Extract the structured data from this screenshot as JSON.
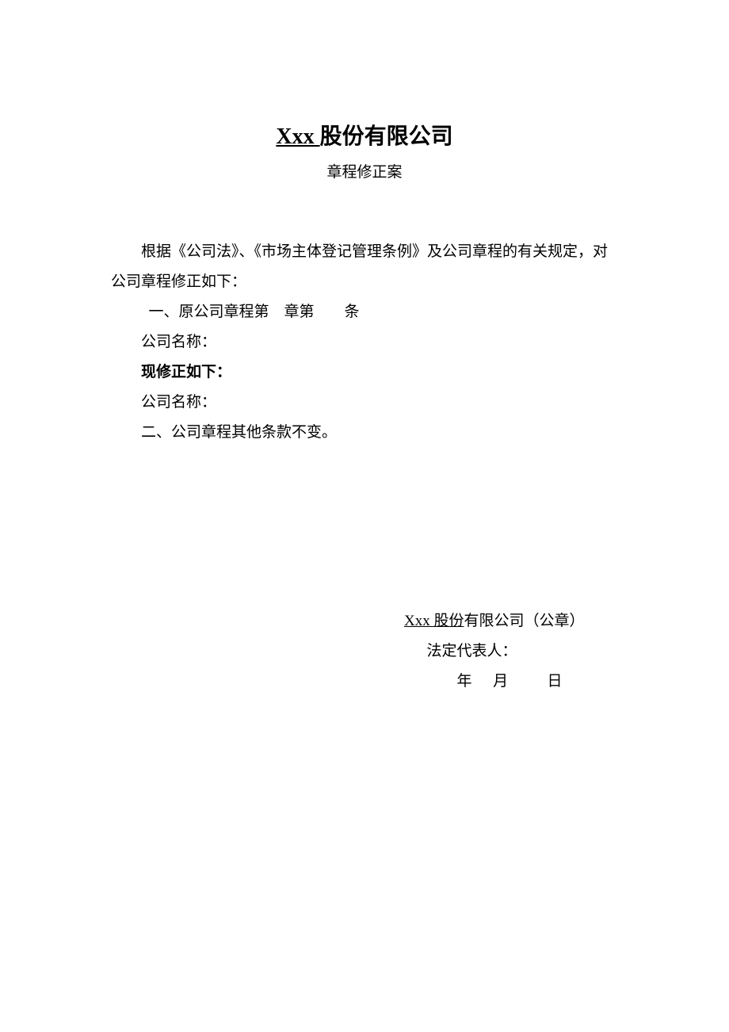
{
  "title": {
    "company_prefix": "Xxx ",
    "company_suffix": "股份有限公司"
  },
  "subtitle": "章程修正案",
  "body": {
    "intro": "根据《公司法》、《市场主体登记管理条例》及公司章程的有关规定，对公司章程修正如下：",
    "item1": "一、原公司章程第　章第　　条",
    "company_name_label1": "公司名称：",
    "amend_label": "现修正如下：",
    "company_name_label2": "公司名称：",
    "item2": "二、公司章程其他条款不变。"
  },
  "signature": {
    "company_prefix": "Xxx 股份",
    "company_suffix": "有限公司（公章）",
    "legal_rep": "法定代表人：",
    "date": "年　月　　日"
  }
}
